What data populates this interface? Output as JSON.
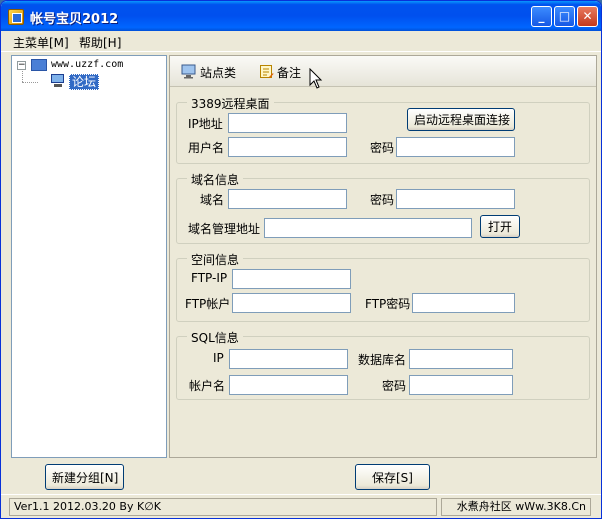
{
  "window": {
    "title": "帐号宝贝2012",
    "minimize_glyph": "_",
    "maximize_glyph": "□",
    "close_glyph": "✕"
  },
  "menu": {
    "items": [
      {
        "label": "主菜单[M]"
      },
      {
        "label": "帮助[H]"
      }
    ]
  },
  "tree": {
    "expander": "−",
    "root": "www.uzzf.com",
    "child": "论坛"
  },
  "toolbar": {
    "site_label": "站点类",
    "notes_label": "备注"
  },
  "groups": {
    "rdp": {
      "title": "3389远程桌面",
      "ip_label": "IP地址",
      "ip_value": "",
      "user_label": "用户名",
      "user_value": "",
      "password_label": "密码",
      "password_value": "",
      "connect_button": "启动远程桌面连接"
    },
    "domain": {
      "title": "域名信息",
      "domain_label": "域名",
      "domain_value": "",
      "password_label": "密码",
      "password_value": "",
      "admin_url_label": "域名管理地址",
      "admin_url_value": "",
      "open_button": "打开"
    },
    "space": {
      "title": "空间信息",
      "ftp_ip_label": "FTP-IP",
      "ftp_ip_value": "",
      "ftp_user_label": "FTP帐户",
      "ftp_user_value": "",
      "ftp_password_label": "FTP密码",
      "ftp_password_value": ""
    },
    "sql": {
      "title": "SQL信息",
      "ip_label": "IP",
      "ip_value": "",
      "db_name_label": "数据库名",
      "db_name_value": "",
      "account_label": "帐户名",
      "account_value": "",
      "password_label": "密码",
      "password_value": ""
    }
  },
  "buttons": {
    "new_group": "新建分组[N]",
    "save": "保存[S]"
  },
  "status": {
    "version": "Ver1.1 2012.03.20 By K∅K",
    "community": "水煮舟社区 wWw.3K8.Cn"
  },
  "icons": {
    "app": "app-icon",
    "folder": "folder-icon",
    "computer": "computer-icon",
    "site": "monitor-icon",
    "notes": "notepad-icon",
    "cursor": "mouse-pointer-icon"
  }
}
